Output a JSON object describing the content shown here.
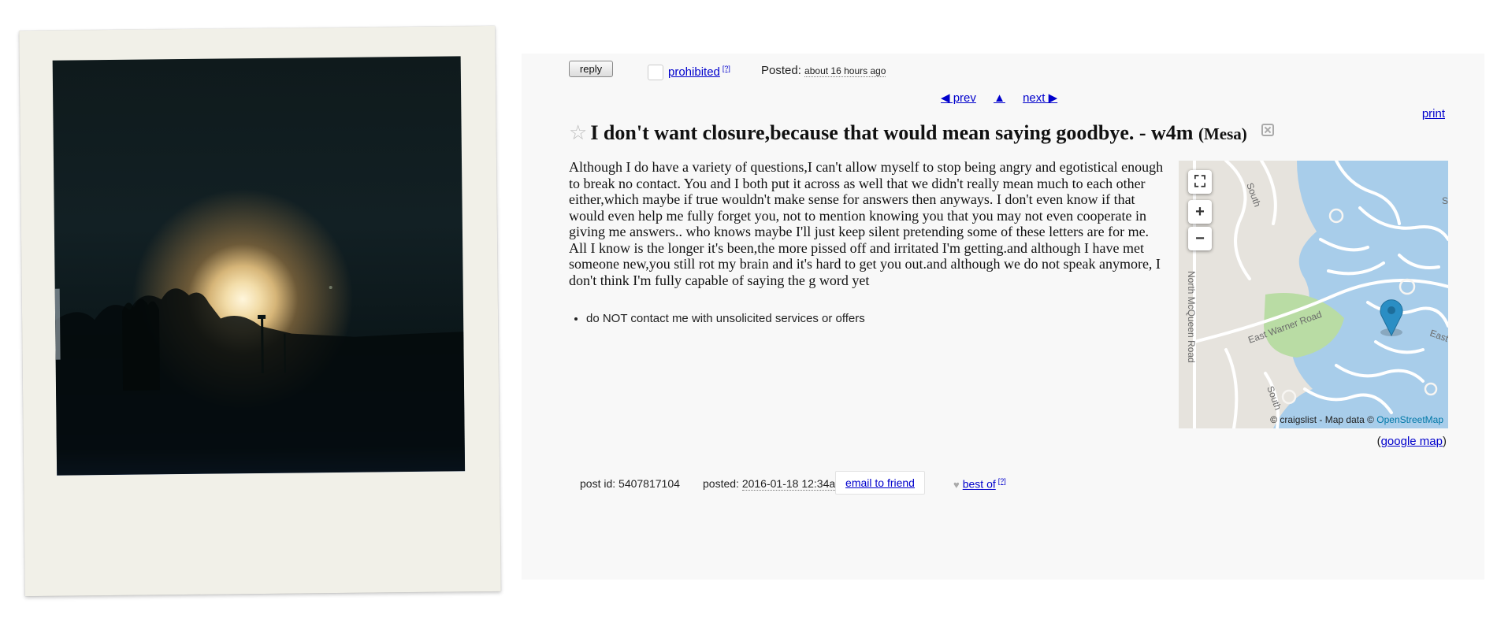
{
  "header": {
    "reply_label": "reply",
    "prohibited_label": "prohibited",
    "help_mark": "[?]",
    "posted_label": "Posted:",
    "posted_ago": "about 16 hours ago"
  },
  "nav": {
    "prev_label": "◀ prev",
    "up_label": "▲",
    "next_label": "next ▶",
    "print_label": "print"
  },
  "posting": {
    "star": "☆",
    "title": "I don't want closure,because that would mean saying goodbye. - w4m",
    "location": "(Mesa)",
    "body": "Although I do have a variety of questions,I can't allow myself to stop being angry and egotistical enough to break no contact. You and I both put it across as well that we didn't really mean much to each other either,which maybe if true wouldn't make sense for answers then anyways. I don't even know if that would even help me fully forget you, not to mention knowing you that you may not even cooperate in giving me answers.. who knows maybe I'll just keep silent pretending some of these letters are for me. All I know is the longer it's been,the more pissed off and irritated I'm getting.and although I have met someone new,you still rot my brain and it's hard to get you out.and although we do not speak anymore, I don't think I'm fully capable of saying the g word yet",
    "notice": "do NOT contact me with unsolicited services or offers"
  },
  "map": {
    "attribution": "© craigslist - Map data ©",
    "osm": "OpenStreetMap",
    "google_open": "(",
    "google_label": "google map",
    "google_close": ")",
    "labels": {
      "north_mcqueen": "North McQueen Road",
      "east_warner": "East Warner Road",
      "south_top": "South",
      "south_bottom": "South",
      "east_right": "East",
      "s_right": "S"
    },
    "controls": {
      "fullscreen": "⛶",
      "zoom_in": "+",
      "zoom_out": "−"
    }
  },
  "footer": {
    "post_id_label": "post id: 5407817104",
    "posted_label": "posted:",
    "posted_date": "2016-01-18 12:34am",
    "email_label": "email to friend",
    "best_of_label": "best of",
    "help_mark": "[?]"
  }
}
